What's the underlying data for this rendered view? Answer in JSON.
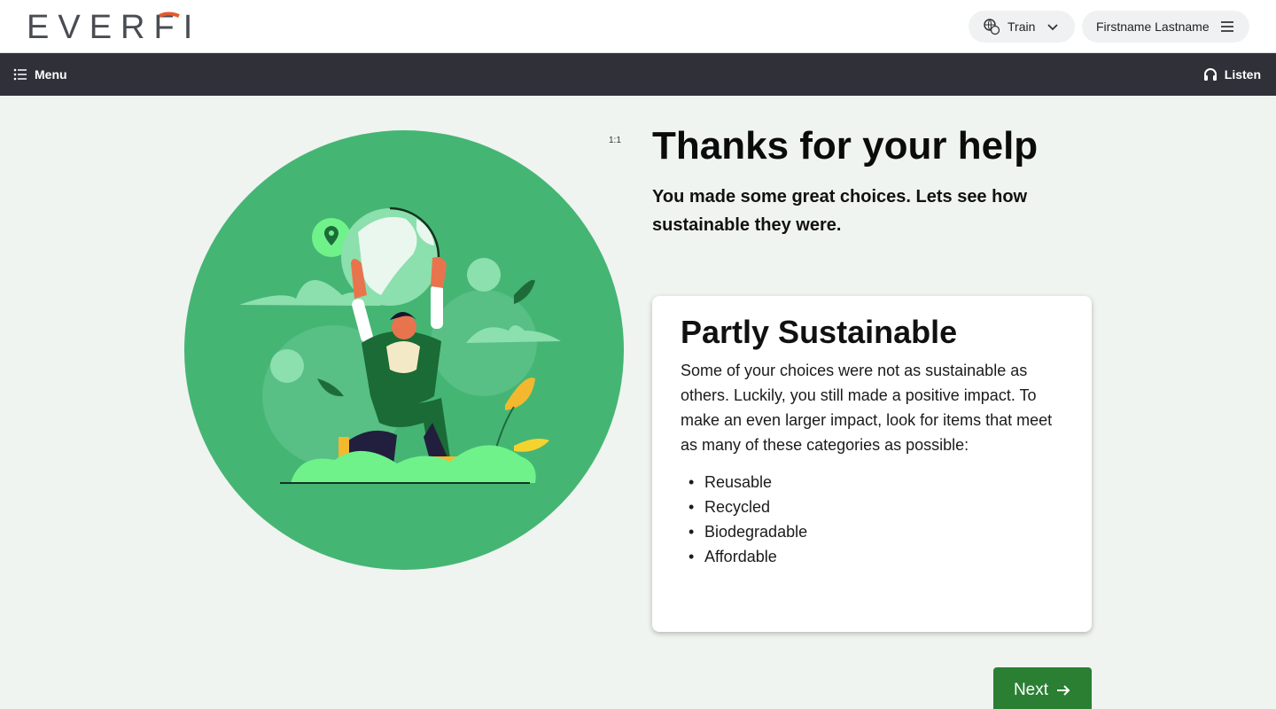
{
  "header": {
    "logo_text": "EVERFI",
    "train_label": "Train",
    "user_name": "Firstname Lastname"
  },
  "nav": {
    "menu_label": "Menu",
    "listen_label": "Listen"
  },
  "content": {
    "aspect_ratio_label": "1:1",
    "heading": "Thanks for your help",
    "subheading": "You made some great choices. Lets see how sustainable they were.",
    "card": {
      "title": "Partly Sustainable",
      "body": "Some of your choices were not as sustainable as others. Luckily, you still made a positive impact. To make an even larger impact, look for items that meet as many of these categories as possible:",
      "items": [
        "Reusable",
        "Recycled",
        "Biodegradable",
        "Affordable"
      ]
    },
    "next_label": "Next"
  },
  "colors": {
    "brand_dark": "#4a4c53",
    "brand_accent": "#e55a2b",
    "navbar": "#2f3038",
    "illustration_circle": "#45b574",
    "next_button": "#2a7f33"
  }
}
